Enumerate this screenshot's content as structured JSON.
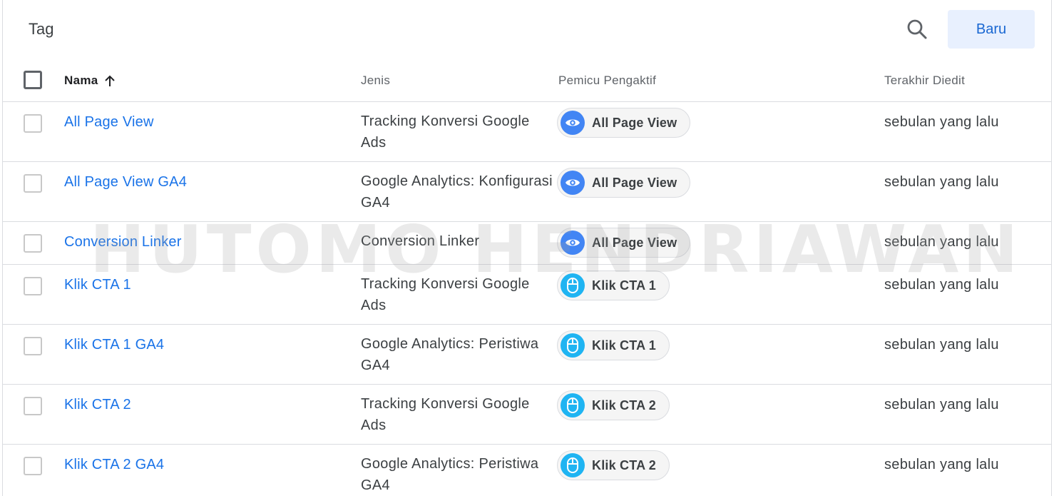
{
  "title": "Tag",
  "new_button": "Baru",
  "columns": {
    "name": "Nama",
    "type": "Jenis",
    "trigger": "Pemicu Pengaktif",
    "edited": "Terakhir Diedit"
  },
  "rows": [
    {
      "name": "All Page View",
      "type": "Tracking Konversi Google Ads",
      "trigger": "All Page View",
      "trigger_icon": "eye-icon",
      "edited": "sebulan yang lalu"
    },
    {
      "name": "All Page View GA4",
      "type": "Google Analytics: Konfigurasi GA4",
      "trigger": "All Page View",
      "trigger_icon": "eye-icon",
      "edited": "sebulan yang lalu"
    },
    {
      "name": "Conversion Linker",
      "type": "Conversion Linker",
      "trigger": "All Page View",
      "trigger_icon": "eye-icon",
      "edited": "sebulan yang lalu"
    },
    {
      "name": "Klik CTA 1",
      "type": "Tracking Konversi Google Ads",
      "trigger": "Klik CTA 1",
      "trigger_icon": "mouse-icon",
      "edited": "sebulan yang lalu"
    },
    {
      "name": "Klik CTA 1 GA4",
      "type": "Google Analytics: Peristiwa GA4",
      "trigger": "Klik CTA 1",
      "trigger_icon": "mouse-icon",
      "edited": "sebulan yang lalu"
    },
    {
      "name": "Klik CTA 2",
      "type": "Tracking Konversi Google Ads",
      "trigger": "Klik CTA 2",
      "trigger_icon": "mouse-icon",
      "edited": "sebulan yang lalu"
    },
    {
      "name": "Klik CTA 2 GA4",
      "type": "Google Analytics: Peristiwa GA4",
      "trigger": "Klik CTA 2",
      "trigger_icon": "mouse-icon",
      "edited": "sebulan yang lalu"
    }
  ],
  "watermark": "HUTOMO HENDRIAWAN",
  "colors": {
    "link": "#1a73e8",
    "primary_button_bg": "#e8f0fe",
    "primary_button_text": "#1967d2",
    "view_trigger": "#4285f4",
    "click_trigger": "#1fb4f2"
  }
}
